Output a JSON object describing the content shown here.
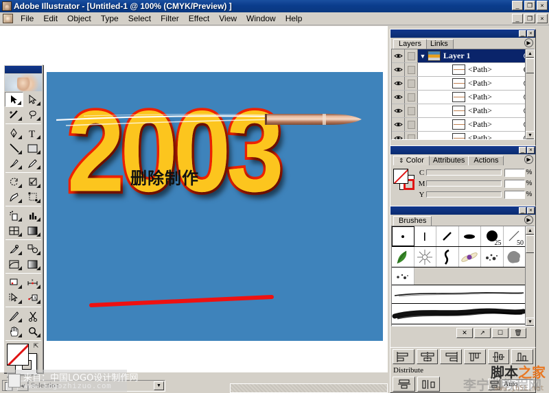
{
  "window": {
    "title": "Adobe Illustrator - [Untitled-1 @ 100% (CMYK/Preview) ]",
    "app_buttons": [
      "_",
      "❐",
      "×"
    ],
    "doc_buttons": [
      "_",
      "❐",
      "×"
    ]
  },
  "menu": {
    "items": [
      {
        "label": "File"
      },
      {
        "label": "Edit"
      },
      {
        "label": "Object"
      },
      {
        "label": "Type"
      },
      {
        "label": "Select"
      },
      {
        "label": "Filter"
      },
      {
        "label": "Effect"
      },
      {
        "label": "View"
      },
      {
        "label": "Window"
      },
      {
        "label": "Help"
      }
    ]
  },
  "artwork": {
    "headline": "2003",
    "subtitle": "删除制作",
    "artboard_color": "#3e83bb",
    "headline_fill": "#fcc51e",
    "headline_stroke": "#ee2200",
    "red_line_color": "#ee1111"
  },
  "toolbox": {
    "tools": [
      {
        "name": "selection-tool",
        "selected": true
      },
      {
        "name": "direct-selection-tool",
        "selected": false
      },
      {
        "name": "magic-wand-tool",
        "selected": false
      },
      {
        "name": "lasso-tool",
        "selected": false
      },
      {
        "name": "pen-tool",
        "selected": false
      },
      {
        "name": "type-tool",
        "selected": false
      },
      {
        "name": "line-tool",
        "selected": false
      },
      {
        "name": "rectangle-tool",
        "selected": false
      },
      {
        "name": "paintbrush-tool",
        "selected": false
      },
      {
        "name": "pencil-tool",
        "selected": false
      },
      {
        "name": "rotate-tool",
        "selected": false
      },
      {
        "name": "scale-tool",
        "selected": false
      },
      {
        "name": "warp-tool",
        "selected": false
      },
      {
        "name": "free-transform-tool",
        "selected": false
      },
      {
        "name": "symbol-sprayer-tool",
        "selected": false
      },
      {
        "name": "column-graph-tool",
        "selected": false
      },
      {
        "name": "mesh-tool",
        "selected": false
      },
      {
        "name": "gradient-tool",
        "selected": false
      },
      {
        "name": "eyedropper-tool",
        "selected": false
      },
      {
        "name": "blend-tool",
        "selected": false
      },
      {
        "name": "slice-tool",
        "selected": false
      },
      {
        "name": "measure-tool",
        "selected": false
      },
      {
        "name": "flare-tool",
        "selected": false
      },
      {
        "name": "graphic-styles-tool",
        "selected": false
      },
      {
        "name": "direct-select-lasso-tool",
        "selected": false
      },
      {
        "name": "area-type-tool",
        "selected": false
      },
      {
        "name": "knife-tool",
        "selected": false
      },
      {
        "name": "scissors-tool",
        "selected": false
      },
      {
        "name": "hand-tool",
        "selected": false
      },
      {
        "name": "zoom-tool",
        "selected": false
      }
    ],
    "screen_modes": [
      "standard-screen-mode",
      "full-screen-with-menu",
      "full-screen-mode"
    ]
  },
  "layers_panel": {
    "tabs": [
      {
        "label": "Layers",
        "active": true
      },
      {
        "label": "Links",
        "active": false
      }
    ],
    "rows": [
      {
        "name": "Layer 1",
        "selected": true,
        "target": "hollow",
        "kind": "layer"
      },
      {
        "name": "<Path>",
        "selected": false,
        "target": "filled",
        "kind": "path"
      },
      {
        "name": "<Path>",
        "selected": false,
        "target": "hollow",
        "kind": "path"
      },
      {
        "name": "<Path>",
        "selected": false,
        "target": "hollow",
        "kind": "path"
      },
      {
        "name": "<Path>",
        "selected": false,
        "target": "hollow",
        "kind": "path"
      },
      {
        "name": "<Path>",
        "selected": false,
        "target": "hollow",
        "kind": "path"
      },
      {
        "name": "<Path>",
        "selected": false,
        "target": "hollow",
        "kind": "path"
      }
    ]
  },
  "color_panel": {
    "tabs": [
      {
        "label": "Color",
        "active": true
      },
      {
        "label": "Attributes",
        "active": false
      },
      {
        "label": "Actions",
        "active": false
      }
    ],
    "channels": [
      {
        "label": "C",
        "value": "",
        "unit": "%"
      },
      {
        "label": "M",
        "value": "",
        "unit": "%"
      },
      {
        "label": "Y",
        "value": "",
        "unit": "%"
      }
    ]
  },
  "brushes_panel": {
    "tabs": [
      {
        "label": "Brushes",
        "active": true
      }
    ],
    "row1": [
      {
        "name": "brush-dot",
        "label": "",
        "selected": true
      },
      {
        "name": "brush-thin-line",
        "label": ""
      },
      {
        "name": "brush-diagonal-stroke",
        "label": ""
      },
      {
        "name": "brush-oval",
        "label": ""
      },
      {
        "name": "brush-round-25",
        "label": "25"
      },
      {
        "name": "brush-diagonal-50",
        "label": "50"
      }
    ],
    "row2": [
      {
        "name": "brush-leaf",
        "label": ""
      },
      {
        "name": "brush-starburst",
        "label": ""
      },
      {
        "name": "brush-curl",
        "label": ""
      },
      {
        "name": "brush-flower",
        "label": ""
      },
      {
        "name": "brush-splatter-small",
        "label": ""
      },
      {
        "name": "brush-ink-blot",
        "label": ""
      }
    ],
    "row3": [
      {
        "name": "brush-splatter-2",
        "label": ""
      }
    ],
    "footer_buttons": [
      "remove-brush-stroke",
      "options-of-selected-object",
      "new-brush",
      "delete-brush"
    ]
  },
  "align_panel": {
    "align_buttons": [
      "horizontal-align-left",
      "horizontal-align-center",
      "horizontal-align-right",
      "vertical-align-top",
      "vertical-align-center",
      "vertical-align-bottom"
    ],
    "distribute_label": "Distribute",
    "distribute_buttons": [
      "distribute-vertical-center",
      "distribute-horizontal-center"
    ],
    "spacing_value": "Auto"
  },
  "statusbar": {
    "value": "Selection",
    "dropdown_icon": "chevron-down-icon",
    "left_arrow_icon": "left-arrow-icon"
  },
  "watermarks": {
    "left_line1": "来自：中国LOGO设计制作网",
    "left_line2": "www.logozhizuo.com",
    "bottom_right_1": "脚本",
    "bottom_right_2": "之家",
    "bottom_right_gray": "李宁典教程网",
    "bottom_right_url": "www.jb51.net"
  }
}
